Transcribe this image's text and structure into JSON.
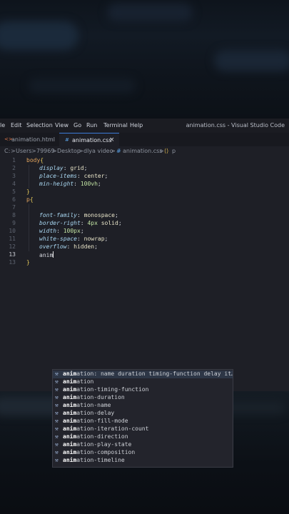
{
  "menu": {
    "items": [
      "le",
      "Edit",
      "Selection",
      "View",
      "Go",
      "Run",
      "Terminal",
      "Help"
    ],
    "window_title": "animation.css - Visual Studio Code"
  },
  "tabs": [
    {
      "icon": "<>",
      "label": "animation.html",
      "active": false
    },
    {
      "icon": "#",
      "label": "animation.css",
      "active": true,
      "close": "×"
    }
  ],
  "breadcrumb": {
    "parts": [
      "C:",
      "Users",
      "79969",
      "Desktop",
      "dlya video",
      "animation.css",
      "p"
    ],
    "separator": ">"
  },
  "editor": {
    "lines": [
      {
        "n": "1"
      },
      {
        "n": "2"
      },
      {
        "n": "3"
      },
      {
        "n": "4"
      },
      {
        "n": "5"
      },
      {
        "n": "6"
      },
      {
        "n": "7"
      },
      {
        "n": "8"
      },
      {
        "n": "9"
      },
      {
        "n": "10"
      },
      {
        "n": "11"
      },
      {
        "n": "12"
      },
      {
        "n": "13"
      }
    ],
    "body_selector": "body",
    "open_brace": "{",
    "close_brace": "}",
    "p_selector": "p",
    "display_prop": "display",
    "display_val": "grid",
    "place_prop": "place-items",
    "place_val": "center",
    "minh_prop": "min-height",
    "minh_val": "100vh",
    "ff_prop": "font-family",
    "ff_val": "monospace",
    "br_prop": "border-right",
    "br_num": "4px",
    "br_val": "solid",
    "w_prop": "width",
    "w_num": "100px",
    "ws_prop": "white-space",
    "ws_val": "nowrap",
    "ov_prop": "overflow",
    "ov_val": "hidden",
    "typing": "anim"
  },
  "suggestions": {
    "typed": "anim",
    "items": [
      {
        "rest": "ation: name duration timing-function delay it…",
        "selected": true
      },
      {
        "rest": "ation"
      },
      {
        "rest": "ation-timing-function"
      },
      {
        "rest": "ation-duration"
      },
      {
        "rest": "ation-name"
      },
      {
        "rest": "ation-delay"
      },
      {
        "rest": "ation-fill-mode"
      },
      {
        "rest": "ation-iteration-count"
      },
      {
        "rest": "ation-direction"
      },
      {
        "rest": "ation-play-state"
      },
      {
        "rest": "ation-composition"
      },
      {
        "rest": "ation-timeline"
      }
    ],
    "icon": "wrench-icon"
  },
  "colors": {
    "accent": "#3b7ad9",
    "selector": "#e2a45d",
    "property": "#a8d6f0",
    "value": "#e9e5c9"
  }
}
